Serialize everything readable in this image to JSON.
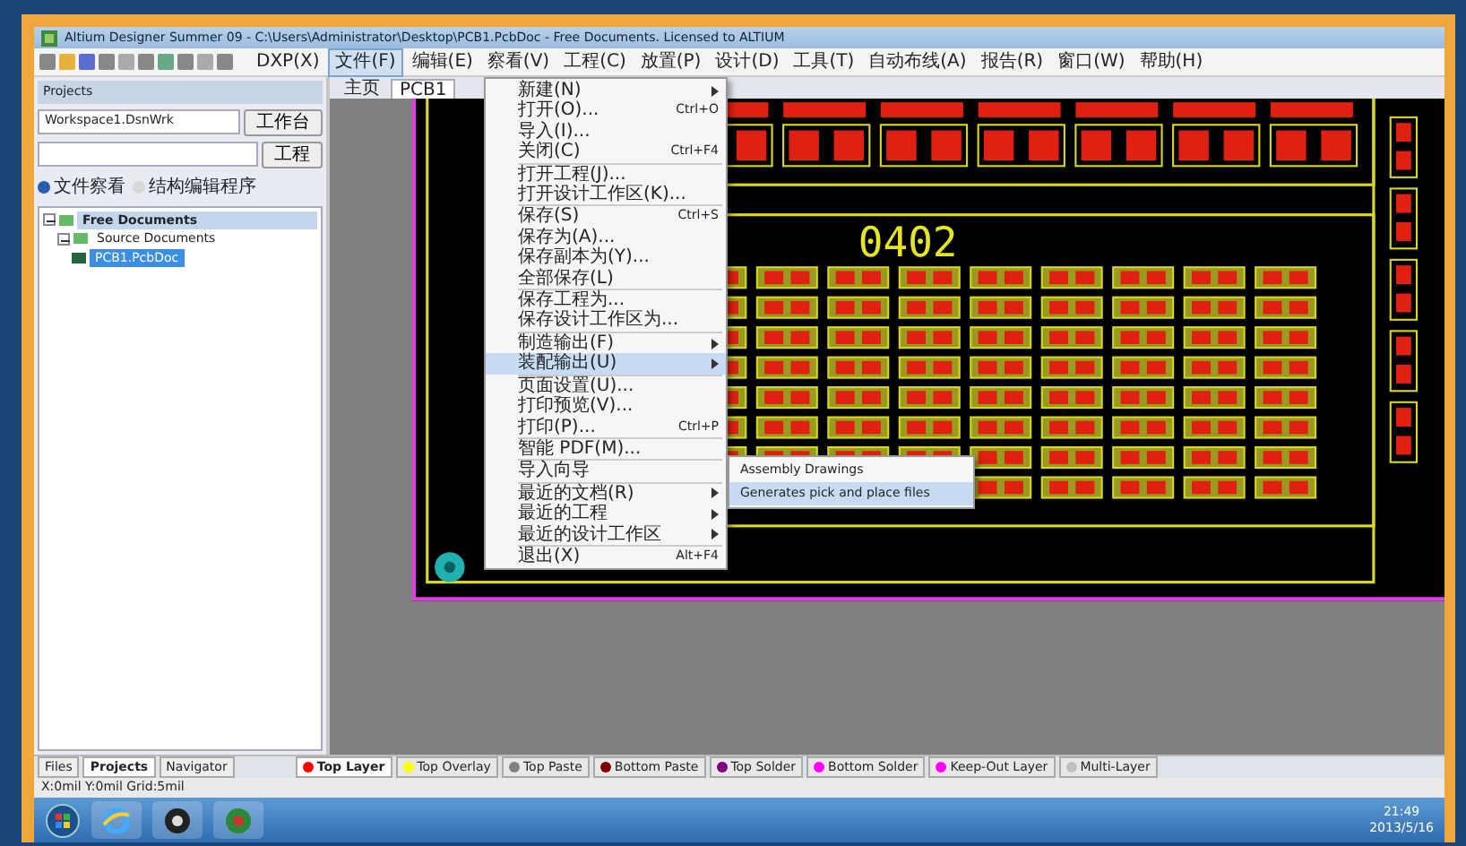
{
  "window": {
    "title": "Altium Designer Summer 09 - C:\\Users\\Administrator\\Desktop\\PCB1.PcbDoc - Free Documents. Licensed to ALTIUM"
  },
  "menu_bar": [
    {
      "label": "DXP(X)",
      "selected": false
    },
    {
      "label": "文件(F)",
      "selected": true
    },
    {
      "label": "编辑(E)",
      "selected": false
    },
    {
      "label": "察看(V)",
      "selected": false
    },
    {
      "label": "工程(C)",
      "selected": false
    },
    {
      "label": "放置(P)",
      "selected": false
    },
    {
      "label": "设计(D)",
      "selected": false
    },
    {
      "label": "工具(T)",
      "selected": false
    },
    {
      "label": "自动布线(A)",
      "selected": false
    },
    {
      "label": "报告(R)",
      "selected": false
    },
    {
      "label": "窗口(W)",
      "selected": false
    },
    {
      "label": "帮助(H)",
      "selected": false
    }
  ],
  "panel": {
    "title": "Projects",
    "workspace": "Workspace1.DsnWrk",
    "workspace_button": "工作台",
    "project_button": "工程",
    "view_options": [
      {
        "label": "文件察看",
        "selected": true
      },
      {
        "label": "结构编辑程序",
        "selected": false
      }
    ],
    "tree": [
      {
        "label": "Free Documents",
        "selected": false,
        "expanded": true,
        "children": [
          {
            "label": "Source Documents",
            "selected": false,
            "expanded": true,
            "children": [
              {
                "label": "PCB1.PcbDoc",
                "selected": true
              }
            ]
          }
        ]
      }
    ],
    "tabs": [
      {
        "label": "Files",
        "selected": false
      },
      {
        "label": "Projects",
        "selected": true
      },
      {
        "label": "Navigator",
        "selected": false
      }
    ]
  },
  "document_tabs": [
    {
      "label": "主页",
      "selected": false
    },
    {
      "label": "PCB1",
      "selected": true
    }
  ],
  "board": {
    "label": "0402"
  },
  "file_menu": [
    {
      "kind": "submenu",
      "label": "新建(N)",
      "selected": false
    },
    {
      "kind": "item",
      "label": "打开(O)...",
      "shortcut": "Ctrl+O",
      "selected": false
    },
    {
      "kind": "item",
      "label": "导入(I)...",
      "selected": false
    },
    {
      "kind": "item",
      "label": "关闭(C)",
      "shortcut": "Ctrl+F4",
      "selected": false
    },
    {
      "kind": "divider"
    },
    {
      "kind": "item",
      "label": "打开工程(J)...",
      "selected": false
    },
    {
      "kind": "item",
      "label": "打开设计工作区(K)...",
      "selected": false
    },
    {
      "kind": "divider"
    },
    {
      "kind": "item",
      "label": "保存(S)",
      "shortcut": "Ctrl+S",
      "selected": false
    },
    {
      "kind": "item",
      "label": "保存为(A)...",
      "selected": false
    },
    {
      "kind": "item",
      "label": "保存副本为(Y)...",
      "selected": false
    },
    {
      "kind": "item",
      "label": "全部保存(L)",
      "selected": false
    },
    {
      "kind": "divider"
    },
    {
      "kind": "item",
      "label": "保存工程为...",
      "selected": false
    },
    {
      "kind": "item",
      "label": "保存设计工作区为...",
      "selected": false
    },
    {
      "kind": "divider"
    },
    {
      "kind": "submenu",
      "label": "制造输出(F)",
      "selected": false
    },
    {
      "kind": "submenu",
      "label": "装配输出(U)",
      "selected": true
    },
    {
      "kind": "divider"
    },
    {
      "kind": "item",
      "label": "页面设置(U)...",
      "selected": false
    },
    {
      "kind": "item",
      "label": "打印预览(V)...",
      "selected": false
    },
    {
      "kind": "item",
      "label": "打印(P)...",
      "shortcut": "Ctrl+P",
      "selected": false
    },
    {
      "kind": "divider"
    },
    {
      "kind": "item",
      "label": "智能 PDF(M)...",
      "selected": false
    },
    {
      "kind": "divider"
    },
    {
      "kind": "item",
      "label": "导入向导",
      "selected": false
    },
    {
      "kind": "divider"
    },
    {
      "kind": "submenu",
      "label": "最近的文档(R)",
      "selected": false
    },
    {
      "kind": "submenu",
      "label": "最近的工程",
      "selected": false
    },
    {
      "kind": "submenu",
      "label": "最近的设计工作区",
      "selected": false
    },
    {
      "kind": "divider"
    },
    {
      "kind": "item",
      "label": "退出(X)",
      "shortcut": "Alt+F4",
      "selected": false
    }
  ],
  "submenu": [
    {
      "label": "Assembly Drawings",
      "selected": false
    },
    {
      "label": "Generates pick and place files",
      "selected": true
    }
  ],
  "layer_tabs": [
    {
      "label": "Top Layer",
      "color": "#ff0000",
      "selected": true
    },
    {
      "label": "Top Overlay",
      "color": "#ffff00",
      "selected": false
    },
    {
      "label": "Top Paste",
      "color": "#808080",
      "selected": false
    },
    {
      "label": "Bottom Paste",
      "color": "#800000",
      "selected": false
    },
    {
      "label": "Top Solder",
      "color": "#800080",
      "selected": false
    },
    {
      "label": "Bottom Solder",
      "color": "#ff00ff",
      "selected": false
    },
    {
      "label": "Keep-Out Layer",
      "color": "#ff00ff",
      "selected": false
    },
    {
      "label": "Multi-Layer",
      "color": "#c0c0c0",
      "selected": false
    }
  ],
  "status_bar": {
    "coordinates": "X:0mil Y:0mil  Grid:5mil"
  },
  "taskbar": {
    "time": "21:49",
    "date": "2013/5/16"
  }
}
